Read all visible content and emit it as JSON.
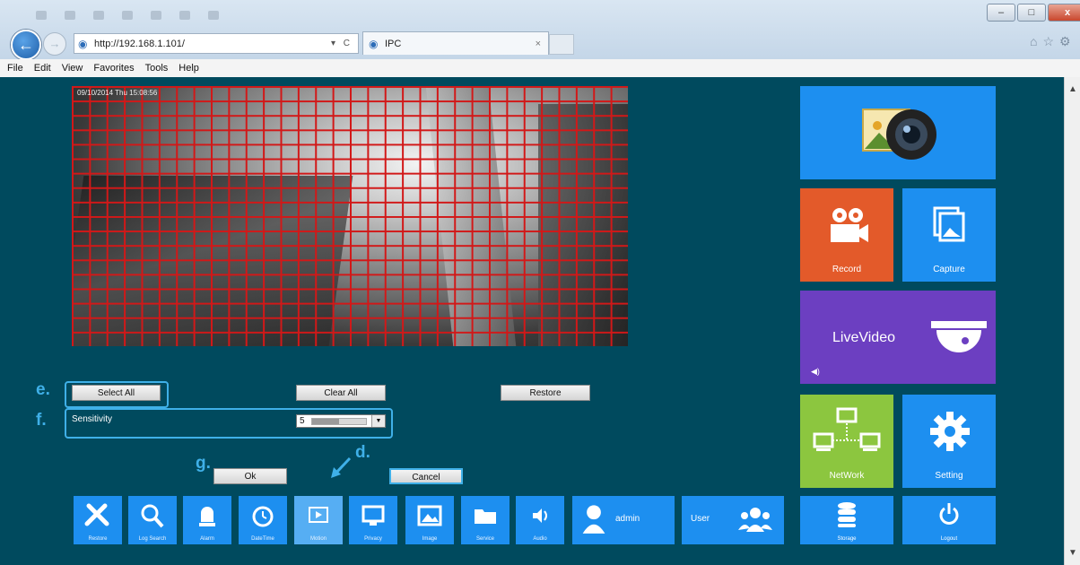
{
  "browser": {
    "url": "http://192.168.1.101/",
    "address_controls": "▾ C",
    "tab_title": "IPC",
    "tab_close": "×",
    "window_min": "–",
    "window_max": "□",
    "window_close": "x"
  },
  "menu": [
    "File",
    "Edit",
    "View",
    "Favorites",
    "Tools",
    "Help"
  ],
  "video": {
    "osd": "09/10/2014 Thu 15:08:56"
  },
  "buttons": {
    "select_all": "Select All",
    "clear_all": "Clear All",
    "restore": "Restore",
    "ok": "Ok",
    "cancel": "Cancel"
  },
  "sensitivity": {
    "label": "Sensitivity",
    "value": "5",
    "level_fraction": 0.5
  },
  "annotations": {
    "e": "e.",
    "f": "f.",
    "g": "g.",
    "d": "d."
  },
  "toolbar": {
    "restore": "Restore",
    "log_search": "Log Search",
    "alarm": "Alarm",
    "datetime": "DateTime",
    "motion": "Motion",
    "privacy": "Privacy",
    "image": "Image",
    "service": "Service",
    "audio": "Audio",
    "admin": "admin",
    "user": "User"
  },
  "tiles": {
    "record": "Record",
    "capture": "Capture",
    "livevideo": "LiveVideo",
    "network": "NetWork",
    "setting": "Setting",
    "storage": "Storage",
    "logout": "Logout"
  },
  "colors": {
    "page_bg": "#004a5e",
    "tile_blue": "#1d8ff0",
    "record_orange": "#e35a2a",
    "livevideo_purple": "#6c3fc1",
    "network_green": "#8cc63f",
    "grid_red": "#d21818",
    "highlight": "#3fb0e8"
  }
}
